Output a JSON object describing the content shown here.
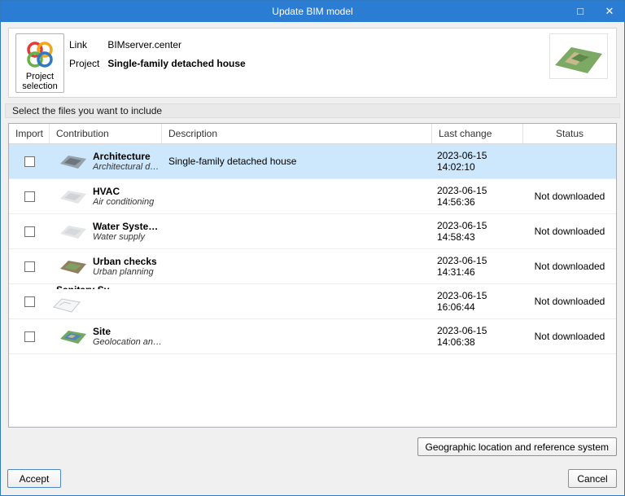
{
  "window": {
    "title": "Update BIM model",
    "maximize_icon": "□",
    "close_icon": "✕"
  },
  "header": {
    "project_selection_label": "Project selection",
    "link_label": "Link",
    "link_value": "BIMserver.center",
    "project_label": "Project",
    "project_value": "Single-family detached house"
  },
  "section": {
    "label": "Select the files you want to include"
  },
  "table": {
    "columns": [
      "Import",
      "Contribution",
      "Description",
      "Last change",
      "Status"
    ],
    "rows": [
      {
        "title": "Architecture",
        "subtitle": "Architectural de...",
        "description": "Single-family detached house",
        "last_change": "2023-06-15 14:02:10",
        "status": "",
        "selected": true,
        "checked": false
      },
      {
        "title": "HVAC",
        "subtitle": "Air conditioning",
        "description": "",
        "last_change": "2023-06-15 14:56:36",
        "status": "Not downloaded",
        "selected": false,
        "checked": false
      },
      {
        "title": "Water Systems",
        "subtitle": "Water supply",
        "description": "",
        "last_change": "2023-06-15 14:58:43",
        "status": "Not downloaded",
        "selected": false,
        "checked": false
      },
      {
        "title": "Urban checks",
        "subtitle": "Urban planning",
        "description": "",
        "last_change": "2023-06-15 14:31:46",
        "status": "Not downloaded",
        "selected": false,
        "checked": false
      },
      {
        "title": "Sanitary Systems",
        "subtitle": "",
        "description": "",
        "last_change": "2023-06-15 16:06:44",
        "status": "Not downloaded",
        "selected": false,
        "checked": false
      },
      {
        "title": "Site",
        "subtitle": "Geolocation and...",
        "description": "",
        "last_change": "2023-06-15 14:06:38",
        "status": "Not downloaded",
        "selected": false,
        "checked": false
      }
    ]
  },
  "buttons": {
    "geo": "Geographic location and reference system",
    "accept": "Accept",
    "cancel": "Cancel"
  },
  "colors": {
    "titlebar": "#2b7cd3",
    "selected_row": "#cde8fc"
  }
}
